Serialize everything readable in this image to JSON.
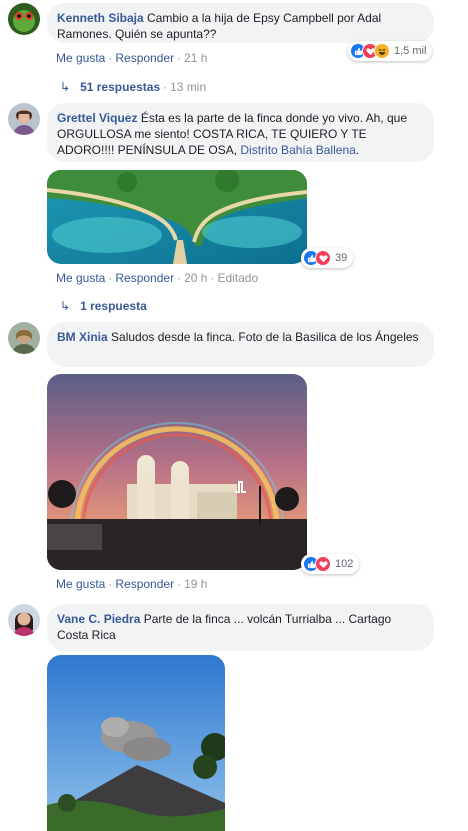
{
  "comments": [
    {
      "author": "Kenneth Sibaja",
      "text": "Cambio a la hija de Epsy Campbell por Adal Ramones. Quién se apunta??",
      "actions": {
        "like": "Me gusta",
        "reply": "Responder",
        "time": "21 h"
      },
      "reactions": {
        "count": "1,5 mil",
        "icons": [
          "like-icon",
          "love-icon",
          "haha-icon"
        ]
      },
      "replies": {
        "label": "51 respuestas",
        "time": "13 min"
      }
    },
    {
      "author": "Grettel Viquez",
      "text": "Ésta es la parte de la finca donde yo vivo. Ah, que ORGULLOSA me siento! COSTA RICA, TE QUIERO Y TE ADORO!!!! PENÍNSULA DE OSA, ",
      "link": "Distrito Bahía Ballena",
      "link_end": ".",
      "actions": {
        "like": "Me gusta",
        "reply": "Responder",
        "time": "20 h",
        "edited": "Editado"
      },
      "reactions": {
        "count": "39",
        "icons": [
          "like-icon",
          "love-icon"
        ]
      },
      "replies": {
        "label": "1 respuesta"
      }
    },
    {
      "author": "BM Xinia",
      "text": "Saludos desde la finca. Foto de la Basilica de los Ángeles",
      "actions": {
        "like": "Me gusta",
        "reply": "Responder",
        "time": "19 h"
      },
      "reactions": {
        "count": "102",
        "icons": [
          "like-icon",
          "love-icon"
        ]
      }
    },
    {
      "author": "Vane C. Piedra",
      "text": "Parte de la finca ... volcán Turrialba ... Cartago Costa Rica"
    }
  ],
  "colors": {
    "link": "#385898",
    "bubble": "#f2f3f5",
    "meta": "#90949c",
    "like": "#1877f2",
    "love": "#f33e58",
    "haha": "#f7b125"
  }
}
